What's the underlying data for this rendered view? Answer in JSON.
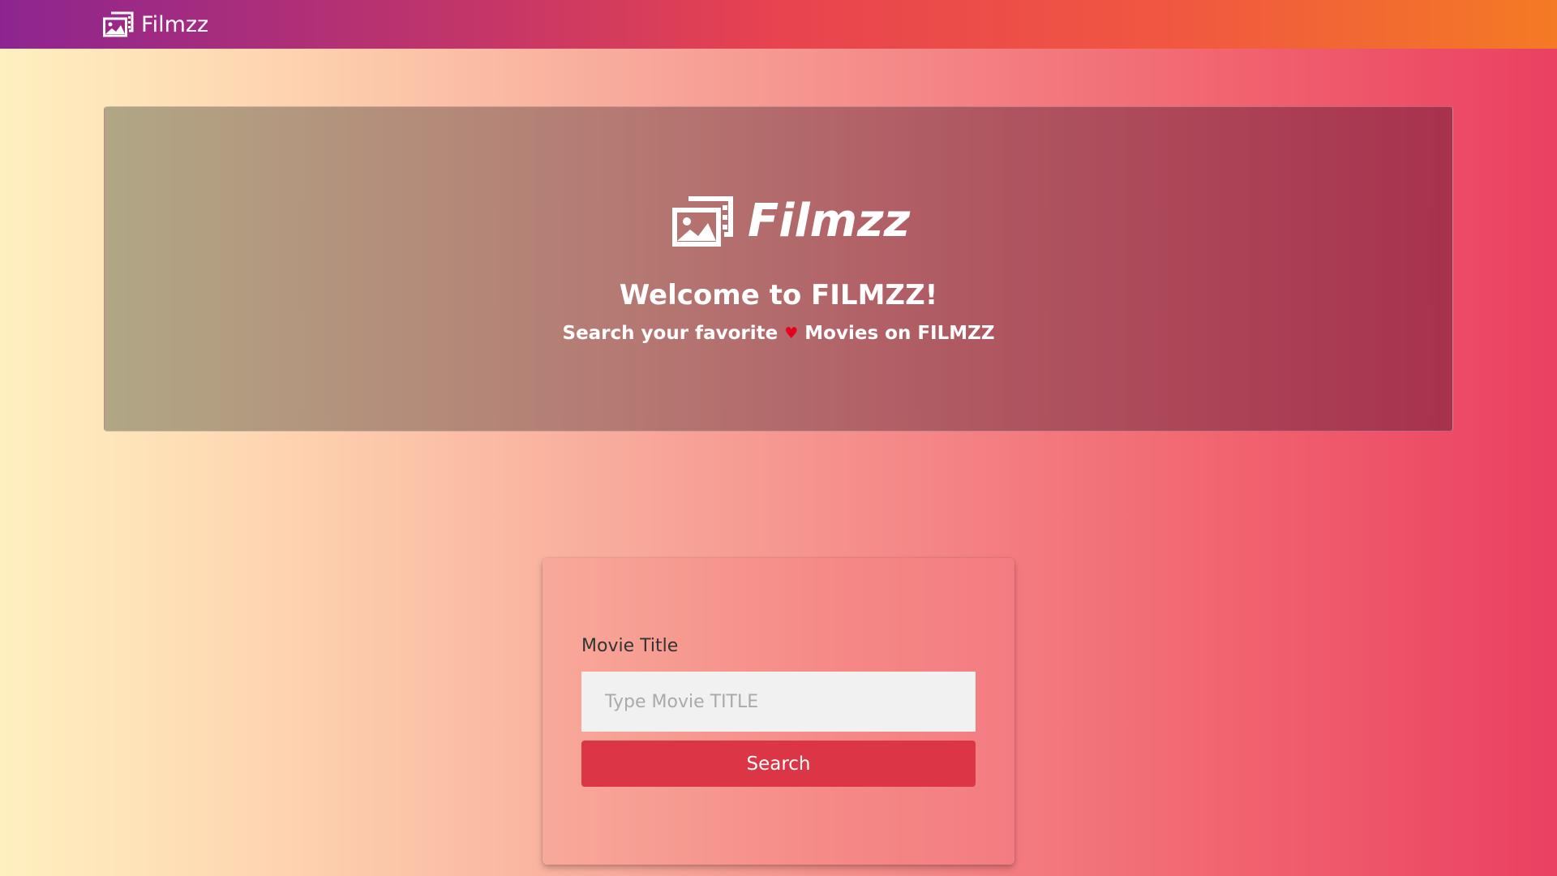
{
  "navbar": {
    "brand_label": "Filmzz",
    "brand_icon": "film-images-icon"
  },
  "hero": {
    "logo_icon": "film-images-icon",
    "logo_text": "Filmzz",
    "title": "Welcome to FILMZZ!",
    "subtitle_before": "Search your favorite",
    "heart_icon": "heart-icon",
    "heart_glyph": "♥",
    "subtitle_after": "Movies on FILMZZ"
  },
  "search_form": {
    "label": "Movie Title",
    "placeholder": "Type Movie TITLE",
    "value": "",
    "button_label": "Search"
  },
  "colors": {
    "navbar_start": "#8d2590",
    "navbar_end": "#f47a24",
    "button": "#dc3545",
    "heart": "#e8001b"
  }
}
